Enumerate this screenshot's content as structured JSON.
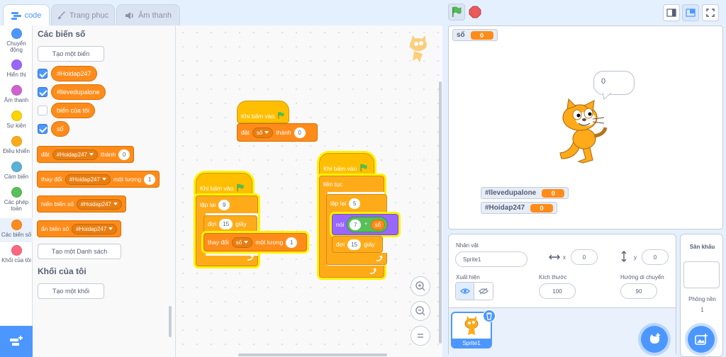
{
  "tabs": [
    {
      "label": "code",
      "icon": "code-icon",
      "active": true
    },
    {
      "label": "Trang phục",
      "icon": "brush-icon",
      "active": false
    },
    {
      "label": "Âm thanh",
      "icon": "speaker-icon",
      "active": false
    }
  ],
  "categories": [
    {
      "label": "Chuyển động",
      "color": "#4c97ff"
    },
    {
      "label": "Hiển thị",
      "color": "#9966ff"
    },
    {
      "label": "Âm thanh",
      "color": "#cf63cf"
    },
    {
      "label": "Sự kiện",
      "color": "#ffd500"
    },
    {
      "label": "Điều khiển",
      "color": "#ffab19"
    },
    {
      "label": "Cảm biến",
      "color": "#5cb1d6"
    },
    {
      "label": "Các phép toán",
      "color": "#59c059"
    },
    {
      "label": "Các biến số",
      "color": "#ff8c1a"
    },
    {
      "label": "Khối của tôi",
      "color": "#ff6680"
    }
  ],
  "palette": {
    "variables_title": "Các biến số",
    "make_variable": "Tạo một biến",
    "variables": [
      {
        "name": "#Hoidap247",
        "checked": true
      },
      {
        "name": "#llevedupalone",
        "checked": true
      },
      {
        "name": "biến của tôi",
        "checked": false
      },
      {
        "name": "số",
        "checked": true
      }
    ],
    "set_block": {
      "word1": "đặt",
      "var": "#Hoidap247",
      "word2": "thành",
      "value": "0"
    },
    "change_block": {
      "word1": "thay đổi",
      "var": "#Hoidap247",
      "word2": "một lượng",
      "value": "1"
    },
    "show_block": {
      "word1": "hiển biến số",
      "var": "#Hoidap247"
    },
    "hide_block": {
      "word1": "ẩn biến số",
      "var": "#Hoidap247"
    },
    "make_list": "Tạo một Danh sách",
    "myblocks_title": "Khối của tôi",
    "make_block": "Tạo một khối"
  },
  "scripts": {
    "s1": {
      "hat": "Khi bấm vào",
      "set": "đặt",
      "var": "số",
      "to": "thành",
      "value": "0"
    },
    "s2": {
      "hat": "Khi bấm vào",
      "repeat": "lặp lại",
      "times": "9",
      "wait": "đợi",
      "wait_val": "15",
      "wait_unit": "giây",
      "change": "thay đổi",
      "var": "số",
      "by": "một lượng",
      "by_val": "1"
    },
    "s3": {
      "hat": "Khi bấm vào",
      "forever": "liên tục",
      "repeat": "lặp lại",
      "times": "5",
      "say": "nói",
      "op_left": "7",
      "op_sym": "*",
      "op_right": "số",
      "wait": "đợi",
      "wait_val": "15",
      "wait_unit": "giây"
    }
  },
  "stage": {
    "monitor_so": {
      "label": "số",
      "value": "0"
    },
    "monitor_lleve": {
      "label": "#llevedupalone",
      "value": "0"
    },
    "monitor_hoidap": {
      "label": "#Hoidap247",
      "value": "0"
    },
    "speech": "0"
  },
  "sprite_info": {
    "sprite_label": "Nhân vật",
    "sprite_name": "Sprite1",
    "x_label": "x",
    "x_value": "0",
    "y_label": "y",
    "y_value": "0",
    "show_label": "Xuất hiện",
    "size_label": "Kích thước",
    "size_value": "100",
    "direction_label": "Hướng di chuyển",
    "direction_value": "90",
    "thumb_name": "Sprite1"
  },
  "stage_pane": {
    "title": "Sân khấu",
    "backdrops_label": "Phông nền",
    "backdrops_count": "1"
  },
  "colors": {
    "accent": "#4c97ff",
    "variables": "#ff8c1a",
    "control": "#ffab19",
    "events": "#ffbf00",
    "looks": "#9966ff",
    "operators": "#59c059"
  }
}
